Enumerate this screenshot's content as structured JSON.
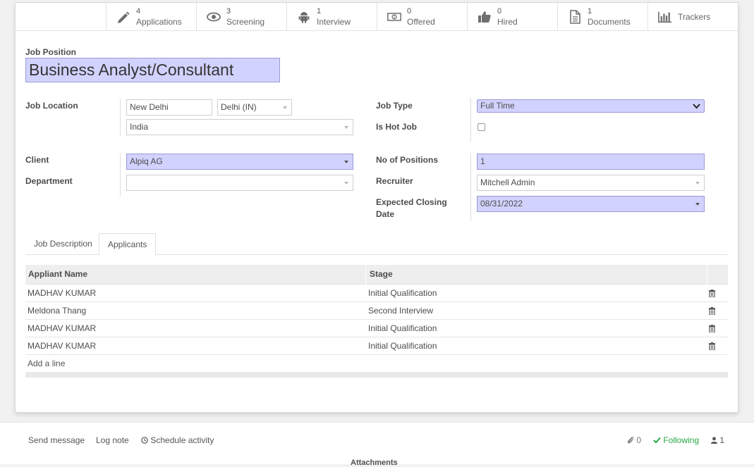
{
  "smart_buttons": [
    {
      "count": "4",
      "label": "Applications",
      "icon": "pencil-icon"
    },
    {
      "count": "3",
      "label": "Screening",
      "icon": "eye-icon"
    },
    {
      "count": "1",
      "label": "Interview",
      "icon": "android-icon"
    },
    {
      "count": "0",
      "label": "Offered",
      "icon": "money-icon"
    },
    {
      "count": "0",
      "label": "Hired",
      "icon": "thumbs-up-icon"
    },
    {
      "count": "1",
      "label": "Documents",
      "icon": "document-icon"
    },
    {
      "count": "",
      "label": "Trackers",
      "icon": "bar-chart-icon"
    }
  ],
  "form": {
    "job_position_label": "Job Position",
    "job_position": "Business Analyst/Consultant",
    "job_location_label": "Job Location",
    "city": "New Delhi",
    "state": "Delhi (IN)",
    "country": "India",
    "client_label": "Client",
    "client": "Alpiq AG",
    "department_label": "Department",
    "department": "",
    "job_type_label": "Job Type",
    "job_type": "Full Time",
    "is_hot_job_label": "Is Hot Job",
    "is_hot_job": false,
    "positions_label": "No of Positions",
    "positions": "1",
    "recruiter_label": "Recruiter",
    "recruiter": "Mitchell Admin",
    "closing_label_line1": "Expected Closing",
    "closing_label_line2": "Date",
    "closing_date": "08/31/2022"
  },
  "tabs": {
    "job_description": "Job Description",
    "applicants": "Applicants",
    "active": "applicants"
  },
  "applicants_table": {
    "headers": [
      "Appliant Name",
      "Stage"
    ],
    "rows": [
      {
        "name": "MADHAV KUMAR",
        "stage": "Initial Qualification"
      },
      {
        "name": "Meldona Thang",
        "stage": "Second Interview"
      },
      {
        "name": "MADHAV KUMAR",
        "stage": "Initial Qualification"
      },
      {
        "name": "MADHAV KUMAR",
        "stage": "Initial Qualification"
      }
    ],
    "add_line": "Add a line"
  },
  "chatter": {
    "send_message": "Send message",
    "log_note": "Log note",
    "schedule_activity": "Schedule activity",
    "attachments_count": "0",
    "following": "Following",
    "followers_count": "1",
    "attachments_heading": "Attachments"
  },
  "colors": {
    "required_field": "#d2d2ff",
    "following_green": "#28a745"
  }
}
